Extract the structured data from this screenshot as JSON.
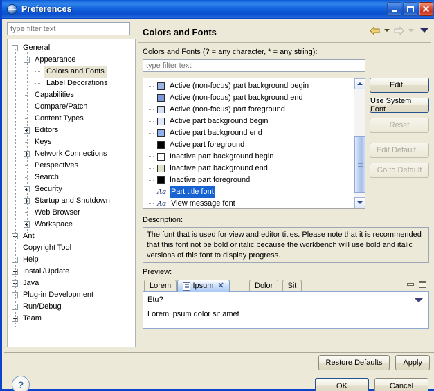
{
  "window": {
    "title": "Preferences",
    "icon": "eclipse-icon",
    "controls": {
      "minimize": "minimize-icon",
      "maximize": "maximize-icon",
      "close": "close-icon",
      "close_glyph": "✕"
    }
  },
  "left": {
    "filter_placeholder": "type filter text",
    "tree": [
      {
        "label": "General",
        "indent": 0,
        "toggle": "minus"
      },
      {
        "label": "Appearance",
        "indent": 1,
        "toggle": "minus"
      },
      {
        "label": "Colors and Fonts",
        "indent": 2,
        "toggle": "leaf",
        "selected": true
      },
      {
        "label": "Label Decorations",
        "indent": 2,
        "toggle": "leaf"
      },
      {
        "label": "Capabilities",
        "indent": 1,
        "toggle": "leaf"
      },
      {
        "label": "Compare/Patch",
        "indent": 1,
        "toggle": "leaf"
      },
      {
        "label": "Content Types",
        "indent": 1,
        "toggle": "leaf"
      },
      {
        "label": "Editors",
        "indent": 1,
        "toggle": "plus"
      },
      {
        "label": "Keys",
        "indent": 1,
        "toggle": "leaf"
      },
      {
        "label": "Network Connections",
        "indent": 1,
        "toggle": "plus"
      },
      {
        "label": "Perspectives",
        "indent": 1,
        "toggle": "leaf"
      },
      {
        "label": "Search",
        "indent": 1,
        "toggle": "leaf"
      },
      {
        "label": "Security",
        "indent": 1,
        "toggle": "plus"
      },
      {
        "label": "Startup and Shutdown",
        "indent": 1,
        "toggle": "plus"
      },
      {
        "label": "Web Browser",
        "indent": 1,
        "toggle": "leaf"
      },
      {
        "label": "Workspace",
        "indent": 1,
        "toggle": "plus"
      },
      {
        "label": "Ant",
        "indent": 0,
        "toggle": "plus"
      },
      {
        "label": "Copyright Tool",
        "indent": 0,
        "toggle": "leaf"
      },
      {
        "label": "Help",
        "indent": 0,
        "toggle": "plus"
      },
      {
        "label": "Install/Update",
        "indent": 0,
        "toggle": "plus"
      },
      {
        "label": "Java",
        "indent": 0,
        "toggle": "plus"
      },
      {
        "label": "Plug-in Development",
        "indent": 0,
        "toggle": "plus"
      },
      {
        "label": "Run/Debug",
        "indent": 0,
        "toggle": "plus"
      },
      {
        "label": "Team",
        "indent": 0,
        "toggle": "plus"
      }
    ]
  },
  "page": {
    "title": "Colors and Fonts",
    "nav": {
      "back_icon": "back-arrow-icon",
      "back_menu_icon": "chevron-down-icon",
      "forward_icon": "forward-arrow-icon",
      "forward_menu_icon": "chevron-down-icon",
      "view_menu_icon": "view-menu-chevron-icon"
    },
    "filter_label": "Colors and Fonts (? = any character, * = any string):",
    "filter_placeholder": "type filter text",
    "items": [
      {
        "label": "Active (non-focus) part background begin",
        "kind": "color",
        "color": "#9bb4e6"
      },
      {
        "label": "Active (non-focus) part background end",
        "kind": "color",
        "color": "#7b97dd"
      },
      {
        "label": "Active (non-focus) part foreground",
        "kind": "color",
        "color": "#d5e0f7"
      },
      {
        "label": "Active part background begin",
        "kind": "color",
        "color": "#dfe8fb"
      },
      {
        "label": "Active part background end",
        "kind": "color",
        "color": "#8fb0ed"
      },
      {
        "label": "Active part foreground",
        "kind": "color",
        "color": "#000000"
      },
      {
        "label": "Inactive part background begin",
        "kind": "color",
        "color": "#ffffff"
      },
      {
        "label": "Inactive part background end",
        "kind": "color",
        "color": "#e3e0cb"
      },
      {
        "label": "Inactive part foreground",
        "kind": "color",
        "color": "#000000"
      },
      {
        "label": "Part title font",
        "kind": "font",
        "glyph": "Aa",
        "selected": true
      },
      {
        "label": "View message font",
        "kind": "font",
        "glyph": "Aa"
      }
    ],
    "buttons": {
      "edit": "Edit...",
      "use_system_font": "Use System Font",
      "reset": "Reset",
      "edit_default": "Edit Default...",
      "go_to_default": "Go to Default"
    },
    "description_label": "Description:",
    "description_text": "The font that is used for view and editor titles.  Please note that it is recommended that this font not be bold or italic because the workbench will use bold and italic versions of this font to display progress.",
    "preview_label": "Preview:",
    "preview": {
      "tabs": [
        {
          "label": "Lorem",
          "active": false,
          "has_icon": false,
          "closable": false
        },
        {
          "label": "Ipsum",
          "active": true,
          "has_icon": true,
          "closable": true,
          "close_glyph": "✕",
          "icon": "document-icon"
        },
        {
          "label": "Dolor",
          "active": false,
          "has_icon": false,
          "closable": false
        },
        {
          "label": "Sit",
          "active": false,
          "has_icon": false,
          "closable": false
        }
      ],
      "minimize_icon": "preview-minimize-icon",
      "maximize_icon": "preview-maximize-icon",
      "combo_value": "Etu?",
      "combo_caret_icon": "chevron-down-icon",
      "body_text": "Lorem ipsum dolor sit amet"
    }
  },
  "footer": {
    "restore_defaults": "Restore Defaults",
    "apply": "Apply",
    "ok": "OK",
    "cancel": "Cancel",
    "help_glyph": "?",
    "help_icon": "help-icon"
  },
  "colors": {
    "titlebar_blue": "#0c59d4",
    "dialog_bg": "#ece9d8",
    "selection_blue": "#1863d2",
    "tree_selection_bg": "#e8e4d2",
    "back_arrow_gold": "#d9a62a"
  }
}
